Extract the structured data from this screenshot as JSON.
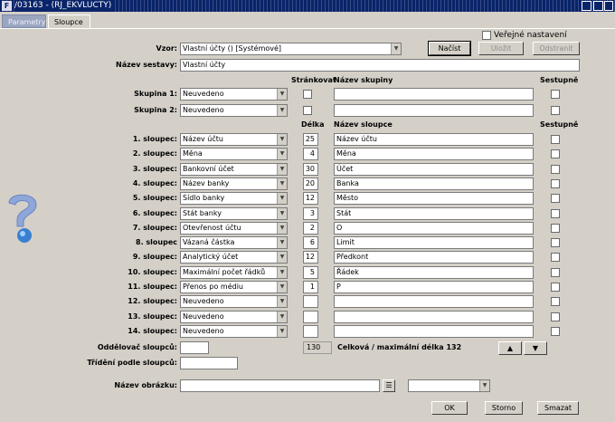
{
  "window": {
    "app_icon": "F",
    "title": "/03163 - (RJ_EKVLUCTY)"
  },
  "tabs": [
    {
      "label": "Parametry"
    },
    {
      "label": "Sloupce"
    }
  ],
  "top": {
    "public_label": "Veřejné nastavení",
    "vzor_label": "Vzor:",
    "vzor_value": "Vlastní účty   ()   [Systémové]",
    "nacist": "Načíst",
    "ulozit": "Uložit",
    "odstranit": "Odstranit",
    "nazev_sestavy_label": "Název sestavy:",
    "nazev_sestavy_value": "Vlastní účty"
  },
  "group_headers": {
    "strankovat": "Stránkovat",
    "nazev_skupiny": "Název skupiny",
    "sestupne": "Sestupně"
  },
  "groups": [
    {
      "label": "Skupina 1:",
      "value": "Neuvedeno",
      "name": ""
    },
    {
      "label": "Skupina 2:",
      "value": "Neuvedeno",
      "name": ""
    }
  ],
  "col_headers": {
    "delka": "Délka",
    "nazev_sloupce": "Název sloupce",
    "sestupne": "Sestupně"
  },
  "columns": [
    {
      "label": "1. sloupec:",
      "value": "Název účtu",
      "length": "25",
      "name": "Název účtu"
    },
    {
      "label": "2. sloupec:",
      "value": "Měna",
      "length": "4",
      "name": "Měna"
    },
    {
      "label": "3. sloupec:",
      "value": "Bankovní účet",
      "length": "30",
      "name": "Účet"
    },
    {
      "label": "4. sloupec:",
      "value": "Název banky",
      "length": "20",
      "name": "Banka"
    },
    {
      "label": "5. sloupec:",
      "value": "Sídlo banky",
      "length": "12",
      "name": "Město"
    },
    {
      "label": "6. sloupec:",
      "value": "Stát banky",
      "length": "3",
      "name": "Stát"
    },
    {
      "label": "7. sloupec:",
      "value": "Otevřenost účtu",
      "length": "2",
      "name": "O"
    },
    {
      "label": "8. sloupec",
      "value": "Vázaná částka",
      "length": "6",
      "name": "Limit"
    },
    {
      "label": "9. sloupec:",
      "value": "Analytický účet",
      "length": "12",
      "name": "Předkont"
    },
    {
      "label": "10. sloupec:",
      "value": "Maximální počet řádků",
      "length": "5",
      "name": "Řádek"
    },
    {
      "label": "11. sloupec:",
      "value": "Přenos po médiu",
      "length": "1",
      "name": "P"
    },
    {
      "label": "12. sloupec:",
      "value": "Neuvedeno",
      "length": "",
      "name": ""
    },
    {
      "label": "13. sloupec:",
      "value": "Neuvedeno",
      "length": "",
      "name": ""
    },
    {
      "label": "14. sloupec:",
      "value": "Neuvedeno",
      "length": "",
      "name": ""
    }
  ],
  "bottom": {
    "oddelovac_label": "Oddělovač sloupců:",
    "oddelovac_value": "",
    "total_value": "130",
    "total_label": "Celková / maximální délka 132",
    "trideni_label": "Třídění podle sloupců:",
    "trideni_value": "",
    "nazev_obrazku_label": "Název obrázku:",
    "nazev_obrazku_value": "",
    "ok": "OK",
    "storno": "Storno",
    "smazat": "Smazat"
  }
}
